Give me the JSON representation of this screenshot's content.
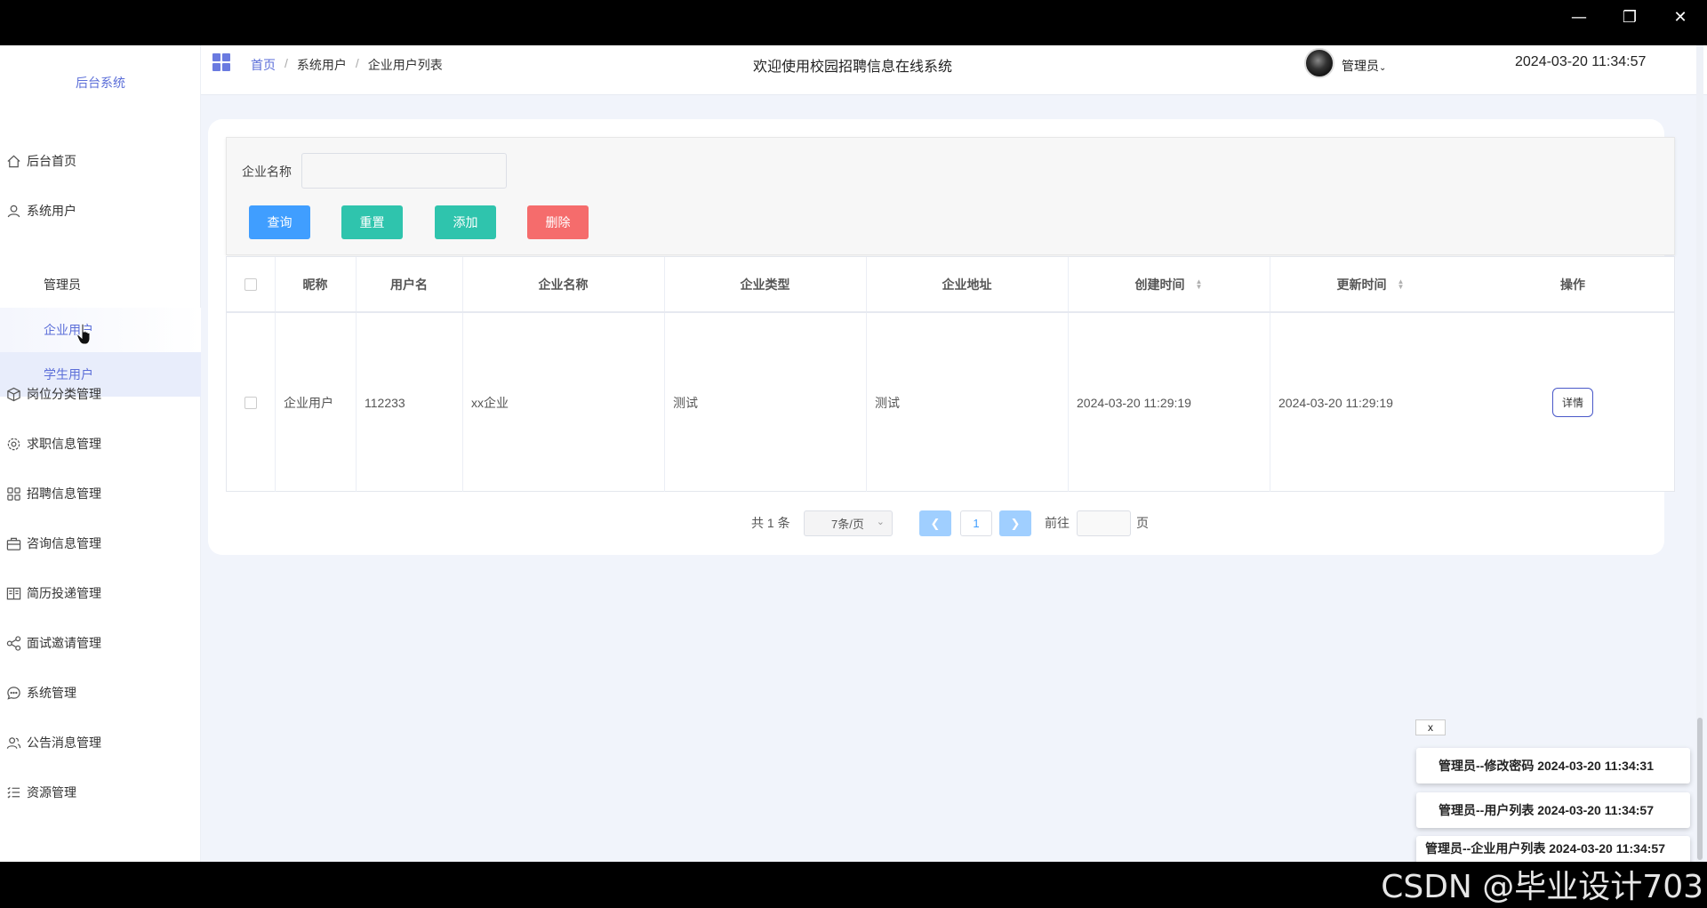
{
  "window": {
    "minimize": "—",
    "restore": "❐",
    "close": "✕"
  },
  "brand": "后台系统",
  "sidebar": {
    "items": [
      {
        "label": "后台首页",
        "icon": "home-icon"
      },
      {
        "label": "系统用户",
        "icon": "user-icon"
      },
      {
        "label": "岗位分类管理",
        "icon": "cube-icon"
      },
      {
        "label": "求职信息管理",
        "icon": "gear-icon"
      },
      {
        "label": "招聘信息管理",
        "icon": "grid-icon"
      },
      {
        "label": "咨询信息管理",
        "icon": "briefcase-icon"
      },
      {
        "label": "简历投递管理",
        "icon": "book-icon"
      },
      {
        "label": "面试邀请管理",
        "icon": "share-icon"
      },
      {
        "label": "系统管理",
        "icon": "chat-icon"
      },
      {
        "label": "公告消息管理",
        "icon": "people-icon"
      },
      {
        "label": "资源管理",
        "icon": "list-icon"
      }
    ],
    "sub_items": [
      "管理员",
      "企业用户",
      "学生用户"
    ]
  },
  "breadcrumb": {
    "home": "首页",
    "sep": "/",
    "level2": "系统用户",
    "current": "企业用户列表"
  },
  "header": {
    "title": "欢迎使用校园招聘信息在线系统",
    "user": "管理员",
    "clock": "2024-03-20 11:34:57"
  },
  "search": {
    "label": "企业名称",
    "placeholder": "",
    "buttons": {
      "query": "查询",
      "reset": "重置",
      "add": "添加",
      "delete": "删除"
    }
  },
  "colors": {
    "query": "#409eff",
    "reset": "#2fc4ad",
    "add": "#2fc4ad",
    "delete": "#f56c6c",
    "accent": "#5b6ed8"
  },
  "table": {
    "headers": [
      "昵称",
      "用户名",
      "企业名称",
      "企业类型",
      "企业地址",
      "创建时间",
      "更新时间",
      "操作"
    ],
    "rows": [
      {
        "nickname": "企业用户",
        "username": "112233",
        "company": "xx企业",
        "type": "测试",
        "address": "测试",
        "created": "2024-03-20 11:29:19",
        "updated": "2024-03-20 11:29:19",
        "action": "详情"
      }
    ]
  },
  "pagination": {
    "total": "共 1 条",
    "page_size": "7条/页",
    "current": "1",
    "goto": "前往",
    "page_unit": "页"
  },
  "notices": {
    "close": "x",
    "items": [
      "管理员--修改密码 2024-03-20 11:34:31",
      "管理员--用户列表 2024-03-20 11:34:57",
      "管理员--企业用户列表 2024-03-20 11:34:57"
    ]
  },
  "watermark": "CSDN @毕业设计703"
}
